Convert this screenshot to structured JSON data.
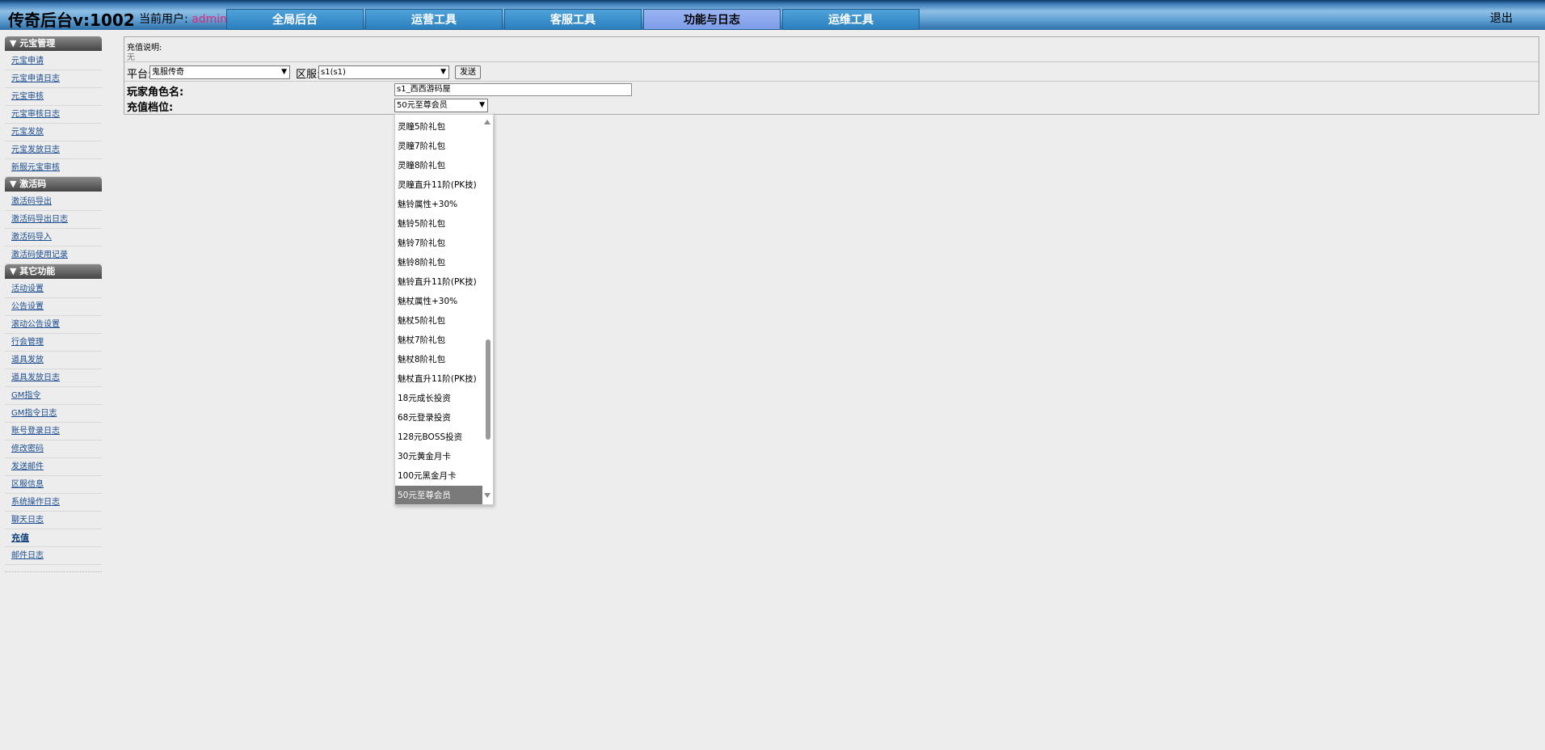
{
  "header": {
    "logo": "传奇后台v:1002",
    "user_label": "当前用户:",
    "user_name": "admin",
    "nav": [
      "全局后台",
      "运营工具",
      "客服工具",
      "功能与日志",
      "运维工具"
    ],
    "active_tab": "功能与日志",
    "logout": "退出"
  },
  "sidebar": {
    "sections": [
      {
        "title": "▼ 元宝管理",
        "items": [
          "元宝申请",
          "元宝申请日志",
          "元宝审核",
          "元宝审核日志",
          "元宝发放",
          "元宝发放日志",
          "新服元宝审核"
        ]
      },
      {
        "title": "▼ 激活码",
        "items": [
          "激活码导出",
          "激活码导出日志",
          "激活码导入",
          "激活码使用记录"
        ]
      },
      {
        "title": "▼ 其它功能",
        "items": [
          "活动设置",
          "公告设置",
          "滚动公告设置",
          "行会管理",
          "道具发放",
          "道具发放日志",
          "GM指令",
          "GM指令日志",
          "账号登录日志",
          "修改密码",
          "发送邮件",
          "区服信息",
          "系统操作日志",
          "聊天日志",
          "充值",
          "邮件日志"
        ]
      }
    ]
  },
  "form": {
    "desc_title": "充值说明:",
    "desc_value": "无",
    "platform_label": "平台:",
    "platform_value": "鬼服传奇",
    "server_label": "区服:",
    "server_value": "s1(s1)",
    "send_button": "发送",
    "role_label": "玩家角色名:",
    "role_value": "s1_西西游码屋",
    "tier_label": "充值档位:",
    "tier_value": "50元至尊会员"
  },
  "dropdown": {
    "options": [
      "灵瞳5阶礼包",
      "灵瞳7阶礼包",
      "灵瞳8阶礼包",
      "灵瞳直升11阶(PK技)",
      "魅铃属性+30%",
      "魅铃5阶礼包",
      "魅铃7阶礼包",
      "魅铃8阶礼包",
      "魅铃直升11阶(PK技)",
      "魅杖属性+30%",
      "魅杖5阶礼包",
      "魅杖7阶礼包",
      "魅杖8阶礼包",
      "魅杖直升11阶(PK技)",
      "18元成长投资",
      "68元登录投资",
      "128元BOSS投资",
      "30元黄金月卡",
      "100元黑金月卡",
      "50元至尊会员"
    ],
    "selected": "50元至尊会员"
  },
  "colors": {
    "accent_user": "#e0287a",
    "nav_active": "#8aa8ee",
    "nav_tab": "#2a7fbf",
    "sidebar_head": "#555555",
    "link": "#1a4c8f"
  }
}
